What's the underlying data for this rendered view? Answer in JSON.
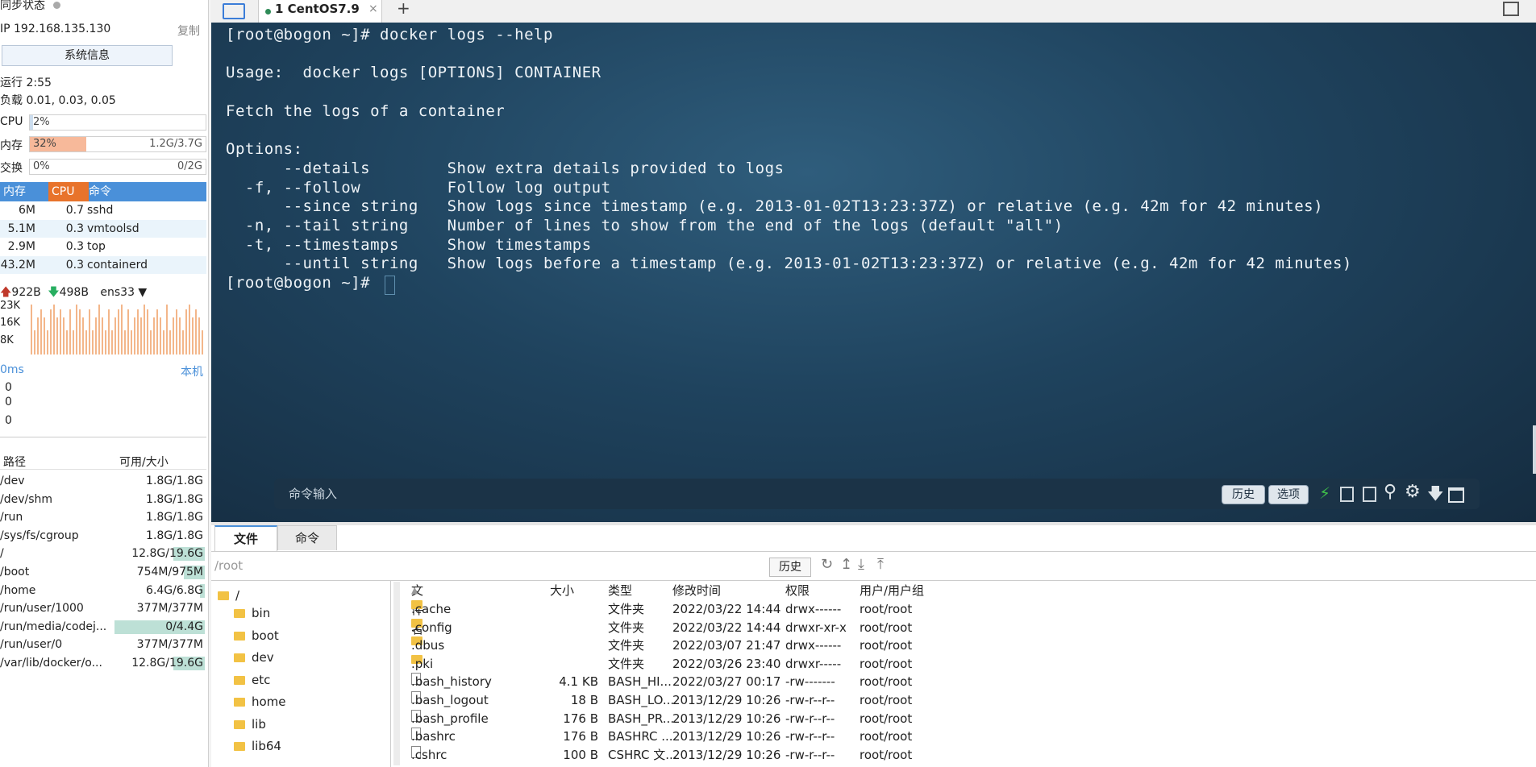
{
  "left": {
    "sync_label": "同步状态",
    "ip": "IP 192.168.135.130",
    "copy_label": "复制",
    "sysinfo_button": "系统信息",
    "uptime": "运行 2:55",
    "load": "负载 0.01, 0.03, 0.05",
    "cpu": {
      "label": "CPU",
      "pct": "2%",
      "fraction": 0.02
    },
    "mem": {
      "label": "内存",
      "pct": "32%",
      "amount": "1.2G/3.7G",
      "fraction": 0.32
    },
    "swap": {
      "label": "交换",
      "pct": "0%",
      "amount": "0/2G",
      "fraction": 0.0
    },
    "proc_headers": {
      "mem": "内存",
      "cpu": "CPU",
      "cmd": "命令"
    },
    "processes": [
      {
        "mem": "6M",
        "cpu": "0.7",
        "cmd": "sshd"
      },
      {
        "mem": "5.1M",
        "cpu": "0.3",
        "cmd": "vmtoolsd"
      },
      {
        "mem": "2.9M",
        "cpu": "0.3",
        "cmd": "top"
      },
      {
        "mem": "43.2M",
        "cpu": "0.3",
        "cmd": "containerd"
      }
    ],
    "net": {
      "up": "922B",
      "down": "498B",
      "iface": "ens33",
      "y_labels": [
        "23K",
        "16K",
        "8K"
      ]
    },
    "latency": {
      "ms": "0ms",
      "host": "本机",
      "values": [
        "0",
        "0",
        "0"
      ]
    },
    "disk_headers": {
      "path": "路径",
      "size": "可用/大小"
    },
    "disks": [
      {
        "path": "/dev",
        "size": "1.8G/1.8G",
        "used": 0.0
      },
      {
        "path": "/dev/shm",
        "size": "1.8G/1.8G",
        "used": 0.0
      },
      {
        "path": "/run",
        "size": "1.8G/1.8G",
        "used": 0.0
      },
      {
        "path": "/sys/fs/cgroup",
        "size": "1.8G/1.8G",
        "used": 0.0
      },
      {
        "path": "/",
        "size": "12.8G/19.6G",
        "used": 0.35
      },
      {
        "path": "/boot",
        "size": "754M/975M",
        "used": 0.23
      },
      {
        "path": "/home",
        "size": "6.4G/6.8G",
        "used": 0.05
      },
      {
        "path": "/run/user/1000",
        "size": "377M/377M",
        "used": 0.0
      },
      {
        "path": "/run/media/codej...",
        "size": "0/4.4G",
        "used": 1.0
      },
      {
        "path": "/run/user/0",
        "size": "377M/377M",
        "used": 0.0
      },
      {
        "path": "/var/lib/docker/o...",
        "size": "12.8G/19.6G",
        "used": 0.35
      }
    ]
  },
  "tabs": {
    "active": "1 CentOS7.9",
    "add": "+"
  },
  "terminal": {
    "lines": [
      "[root@bogon ~]# docker logs --help",
      "",
      "Usage:  docker logs [OPTIONS] CONTAINER",
      "",
      "Fetch the logs of a container",
      "",
      "Options:",
      "      --details        Show extra details provided to logs",
      "  -f, --follow         Follow log output",
      "      --since string   Show logs since timestamp (e.g. 2013-01-02T13:23:37Z) or relative (e.g. 42m for 42 minutes)",
      "  -n, --tail string    Number of lines to show from the end of the logs (default \"all\")",
      "  -t, --timestamps     Show timestamps",
      "      --until string   Show logs before a timestamp (e.g. 2013-01-02T13:23:37Z) or relative (e.g. 42m for 42 minutes)",
      "[root@bogon ~]# "
    ],
    "cmd_placeholder": "命令输入",
    "history_btn": "历史",
    "options_btn": "选项"
  },
  "files": {
    "tabs": [
      "文件",
      "命令"
    ],
    "path": "/root",
    "history_btn": "历史",
    "tree_root": "/",
    "tree": [
      "bin",
      "boot",
      "dev",
      "etc",
      "home",
      "lib",
      "lib64"
    ],
    "headers": {
      "name": "文件名",
      "size": "大小",
      "type": "类型",
      "mtime": "修改时间",
      "perm": "权限",
      "owner": "用户/用户组"
    },
    "rows": [
      {
        "name": ".cache",
        "size": "",
        "type": "文件夹",
        "mtime": "2022/03/22 14:44",
        "perm": "drwx------",
        "owner": "root/root",
        "dir": true
      },
      {
        "name": ".config",
        "size": "",
        "type": "文件夹",
        "mtime": "2022/03/22 14:44",
        "perm": "drwxr-xr-x",
        "owner": "root/root",
        "dir": true
      },
      {
        "name": ".dbus",
        "size": "",
        "type": "文件夹",
        "mtime": "2022/03/07 21:47",
        "perm": "drwx------",
        "owner": "root/root",
        "dir": true
      },
      {
        "name": ".pki",
        "size": "",
        "type": "文件夹",
        "mtime": "2022/03/26 23:40",
        "perm": "drwxr-----",
        "owner": "root/root",
        "dir": true
      },
      {
        "name": ".bash_history",
        "size": "4.1 KB",
        "type": "BASH_HI...",
        "mtime": "2022/03/27 00:17",
        "perm": "-rw-------",
        "owner": "root/root",
        "dir": false
      },
      {
        "name": ".bash_logout",
        "size": "18 B",
        "type": "BASH_LO...",
        "mtime": "2013/12/29 10:26",
        "perm": "-rw-r--r--",
        "owner": "root/root",
        "dir": false
      },
      {
        "name": ".bash_profile",
        "size": "176 B",
        "type": "BASH_PR...",
        "mtime": "2013/12/29 10:26",
        "perm": "-rw-r--r--",
        "owner": "root/root",
        "dir": false
      },
      {
        "name": ".bashrc",
        "size": "176 B",
        "type": "BASHRC ...",
        "mtime": "2013/12/29 10:26",
        "perm": "-rw-r--r--",
        "owner": "root/root",
        "dir": false
      },
      {
        "name": ".cshrc",
        "size": "100 B",
        "type": "CSHRC 文...",
        "mtime": "2013/12/29 10:26",
        "perm": "-rw-r--r--",
        "owner": "root/root",
        "dir": false
      }
    ]
  },
  "colors": {
    "accent": "#4a90d9",
    "cpu_header": "#e8732b",
    "mem_fill": "#f7b99a",
    "disk_fill": "#bde0d6"
  }
}
